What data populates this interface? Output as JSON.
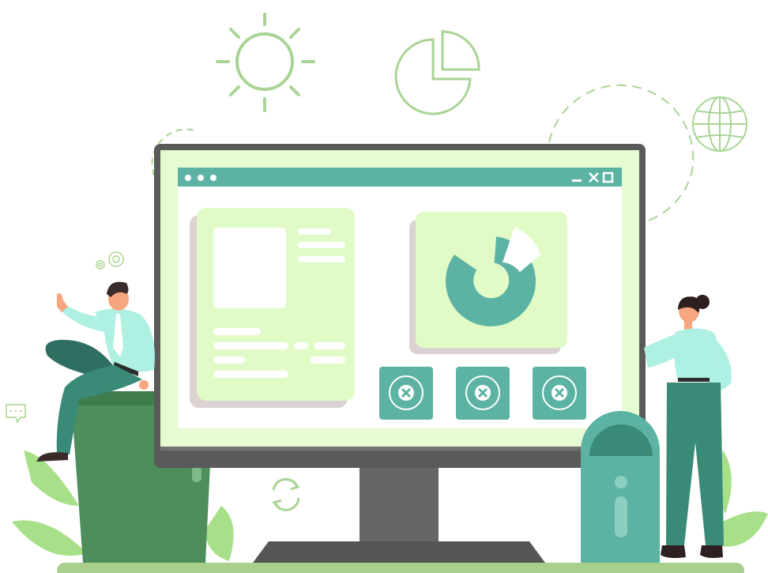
{
  "colors": {
    "accent_green": "#5cb3a3",
    "dark_teal": "#3a8a78",
    "screen_bg": "#e6fbd2",
    "card_bg": "#e1fbc6",
    "card_shadow": "#dcd2d2",
    "monitor_frame": "#5a5a5a",
    "monitor_bezel": "#737373",
    "outline_green": "#a9d494",
    "leaf_green": "#a8e08a",
    "bin_green": "#4e8e5c",
    "ground": "#a8cf8c",
    "skin": "#f6a57e",
    "shirt": "#aef0e1",
    "pants": "#3a8a78"
  },
  "icons": [
    "sun-icon",
    "pie-chart-outline-icon",
    "globe-icon",
    "gears-icon",
    "chat-bubble-icon",
    "refresh-icon",
    "donut-chart-icon",
    "close-icon",
    "minimize-icon",
    "maximize-icon",
    "window-dots-icon",
    "trash-can-icon"
  ]
}
